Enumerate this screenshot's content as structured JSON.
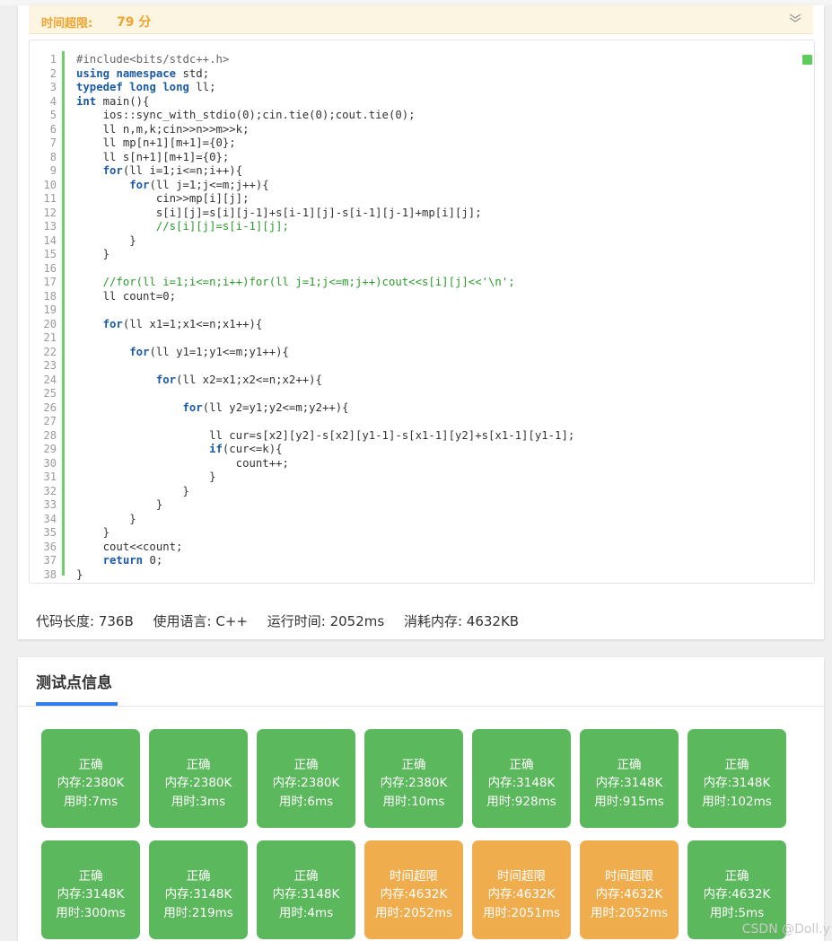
{
  "status": {
    "label": "时间超限:",
    "time": "79 分"
  },
  "code_lines": [
    "#include<bits/stdc++.h>",
    "using namespace std;",
    "typedef long long ll;",
    "int main(){",
    "    ios::sync_with_stdio(0);cin.tie(0);cout.tie(0);",
    "    ll n,m,k;cin>>n>>m>>k;",
    "    ll mp[n+1][m+1]={0};",
    "    ll s[n+1][m+1]={0};",
    "    for(ll i=1;i<=n;i++){",
    "        for(ll j=1;j<=m;j++){",
    "            cin>>mp[i][j];",
    "            s[i][j]=s[i][j-1]+s[i-1][j]-s[i-1][j-1]+mp[i][j];",
    "            //s[i][j]=s[i-1][j];",
    "        }",
    "    }",
    "",
    "    //for(ll i=1;i<=n;i++)for(ll j=1;j<=m;j++)cout<<s[i][j]<<'\\n';",
    "    ll count=0;",
    "",
    "    for(ll x1=1;x1<=n;x1++){",
    "",
    "        for(ll y1=1;y1<=m;y1++){",
    "",
    "            for(ll x2=x1;x2<=n;x2++){",
    "",
    "                for(ll y2=y1;y2<=m;y2++){",
    "",
    "                    ll cur=s[x2][y2]-s[x2][y1-1]-s[x1-1][y2]+s[x1-1][y1-1];",
    "                    if(cur<=k){",
    "                        count++;",
    "                    }",
    "                }",
    "            }",
    "        }",
    "    }",
    "    cout<<count;",
    "    return 0;",
    "}"
  ],
  "meta": {
    "length": "代码长度: 736B",
    "language": "使用语言: C++",
    "runtime": "运行时间: 2052ms",
    "memory": "消耗内存: 4632KB"
  },
  "tab": {
    "label": "测试点信息"
  },
  "testpoints": [
    {
      "status": "正确",
      "memory": "内存:2380K",
      "time": "用时:7ms",
      "color": "#5cb85c"
    },
    {
      "status": "正确",
      "memory": "内存:2380K",
      "time": "用时:3ms",
      "color": "#5cb85c"
    },
    {
      "status": "正确",
      "memory": "内存:2380K",
      "time": "用时:6ms",
      "color": "#5cb85c"
    },
    {
      "status": "正确",
      "memory": "内存:2380K",
      "time": "用时:10ms",
      "color": "#5cb85c"
    },
    {
      "status": "正确",
      "memory": "内存:3148K",
      "time": "用时:928ms",
      "color": "#5cb85c"
    },
    {
      "status": "正确",
      "memory": "内存:3148K",
      "time": "用时:915ms",
      "color": "#5cb85c"
    },
    {
      "status": "正确",
      "memory": "内存:3148K",
      "time": "用时:102ms",
      "color": "#5cb85c"
    },
    {
      "status": "正确",
      "memory": "内存:3148K",
      "time": "用时:300ms",
      "color": "#5cb85c"
    },
    {
      "status": "正确",
      "memory": "内存:3148K",
      "time": "用时:219ms",
      "color": "#5cb85c"
    },
    {
      "status": "正确",
      "memory": "内存:3148K",
      "time": "用时:4ms",
      "color": "#5cb85c"
    },
    {
      "status": "时间超限",
      "memory": "内存:4632K",
      "time": "用时:2052ms",
      "color": "#f0ad4e"
    },
    {
      "status": "时间超限",
      "memory": "内存:4632K",
      "time": "用时:2051ms",
      "color": "#f0ad4e"
    },
    {
      "status": "时间超限",
      "memory": "内存:4632K",
      "time": "用时:2052ms",
      "color": "#f0ad4e"
    },
    {
      "status": "正确",
      "memory": "内存:4632K",
      "time": "用时:5ms",
      "color": "#5cb85c"
    }
  ],
  "watermark": "CSDN @Doll.y"
}
